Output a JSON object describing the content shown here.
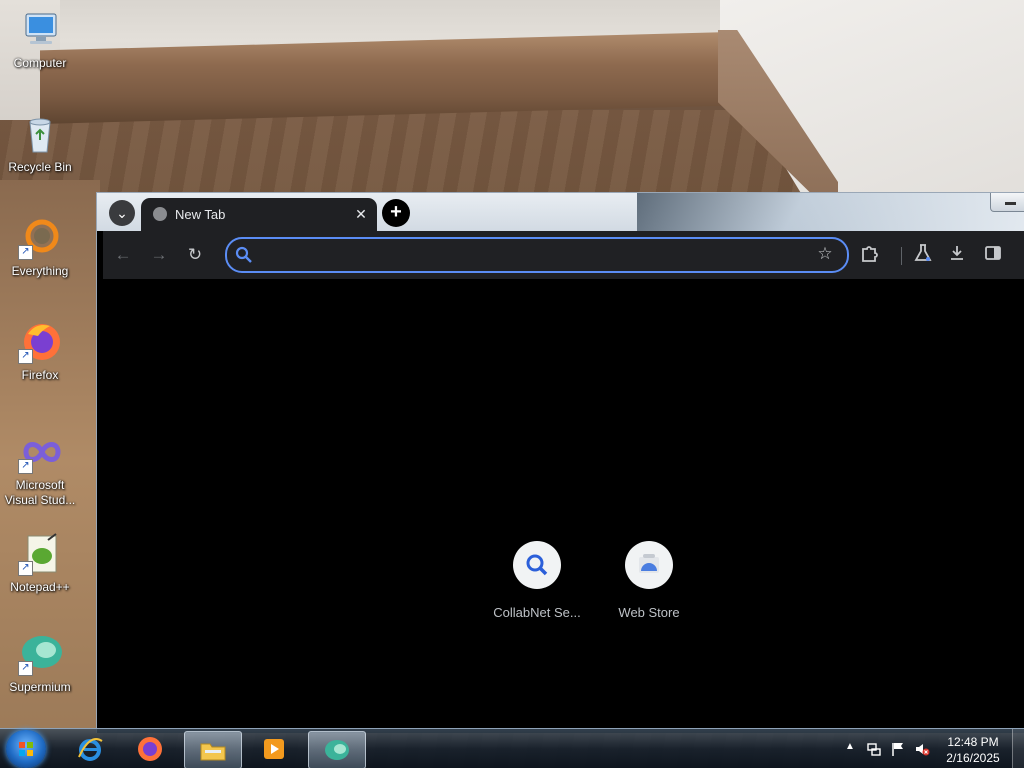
{
  "desktop": {
    "icons": [
      {
        "label": "Computer"
      },
      {
        "label": "Recycle Bin"
      },
      {
        "label": "Everything"
      },
      {
        "label": "Firefox"
      },
      {
        "label": "Microsoft Visual Stud..."
      },
      {
        "label": "Notepad++"
      },
      {
        "label": "Supermium"
      }
    ]
  },
  "browser": {
    "tab": {
      "title": "New Tab",
      "close_glyph": "✕"
    },
    "tab_search_glyph": "⌄",
    "new_tab_glyph": "+",
    "toolbar": {
      "back_glyph": "←",
      "forward_glyph": "→",
      "reload_glyph": "↻",
      "star_glyph": "☆",
      "extensions_icon": "puzzle-icon",
      "labs_icon": "flask-icon",
      "download_icon": "download-icon",
      "side_panel_icon": "side-panel-icon"
    },
    "omnibox": {
      "value": "",
      "placeholder": ""
    },
    "shortcuts": [
      {
        "label": "CollabNet Se...",
        "icon": "search-icon"
      },
      {
        "label": "Web Store",
        "icon": "web-store-icon"
      }
    ],
    "colors": {
      "accent": "#5b8df5",
      "tab_bg": "#1f2023",
      "page_bg": "#000000"
    }
  },
  "taskbar": {
    "items": [
      {
        "name": "internet-explorer"
      },
      {
        "name": "firefox"
      },
      {
        "name": "file-explorer",
        "active": true
      },
      {
        "name": "media-player"
      },
      {
        "name": "supermium",
        "active": true
      }
    ],
    "tray_up_glyph": "▲",
    "clock": {
      "time": "12:48 PM",
      "date": "2/16/2025"
    }
  }
}
